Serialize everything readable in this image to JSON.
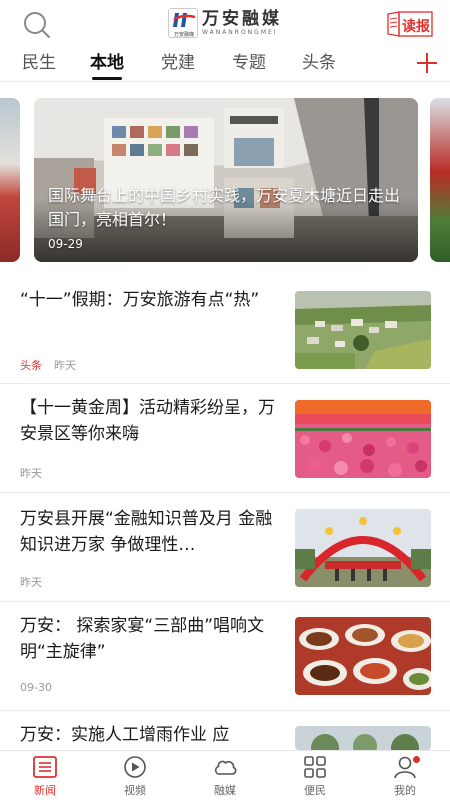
{
  "header": {
    "logo_cn": "万安融媒",
    "logo_en": "WANANRONGMEI",
    "logo_small": "万安融媒",
    "read_report_label": "读报",
    "icons": {
      "search": "search-icon",
      "read_report": "newspaper-icon"
    }
  },
  "tabs": [
    {
      "label": "民生",
      "active": false
    },
    {
      "label": "本地",
      "active": true
    },
    {
      "label": "党建",
      "active": false
    },
    {
      "label": "专题",
      "active": false
    },
    {
      "label": "头条",
      "active": false
    }
  ],
  "tab_add_icon": "plus-icon",
  "carousel": {
    "caption": "国际舞台上的中国乡村实践，万安夏木塘近日走出国门，亮相首尔！",
    "date": "09-29"
  },
  "news": [
    {
      "title": "“十一”假期：万安旅游有点“热”",
      "tag": "头条",
      "time": "昨天"
    },
    {
      "title": "【十一黄金周】活动精彩纷呈，万安景区等你来嗨",
      "tag": "",
      "time": "昨天"
    },
    {
      "title": "万安县开展“金融知识普及月 金融知识进万家 争做理性…",
      "tag": "",
      "time": "昨天"
    },
    {
      "title": "万安： 探索家宴“三部曲”唱响文明“主旋律”",
      "tag": "",
      "time": "09-30"
    },
    {
      "title": "万安：实施人工增雨作业 应",
      "tag": "",
      "time": ""
    }
  ],
  "bottom_nav": [
    {
      "label": "新闻",
      "icon": "news-icon",
      "active": true
    },
    {
      "label": "视频",
      "icon": "video-icon",
      "active": false
    },
    {
      "label": "融媒",
      "icon": "cloud-icon",
      "active": false
    },
    {
      "label": "便民",
      "icon": "grid-icon",
      "active": false
    },
    {
      "label": "我的",
      "icon": "user-icon",
      "active": false
    }
  ],
  "colors": {
    "accent": "#e0302e",
    "text": "#1a1a1a",
    "meta": "#999999"
  }
}
